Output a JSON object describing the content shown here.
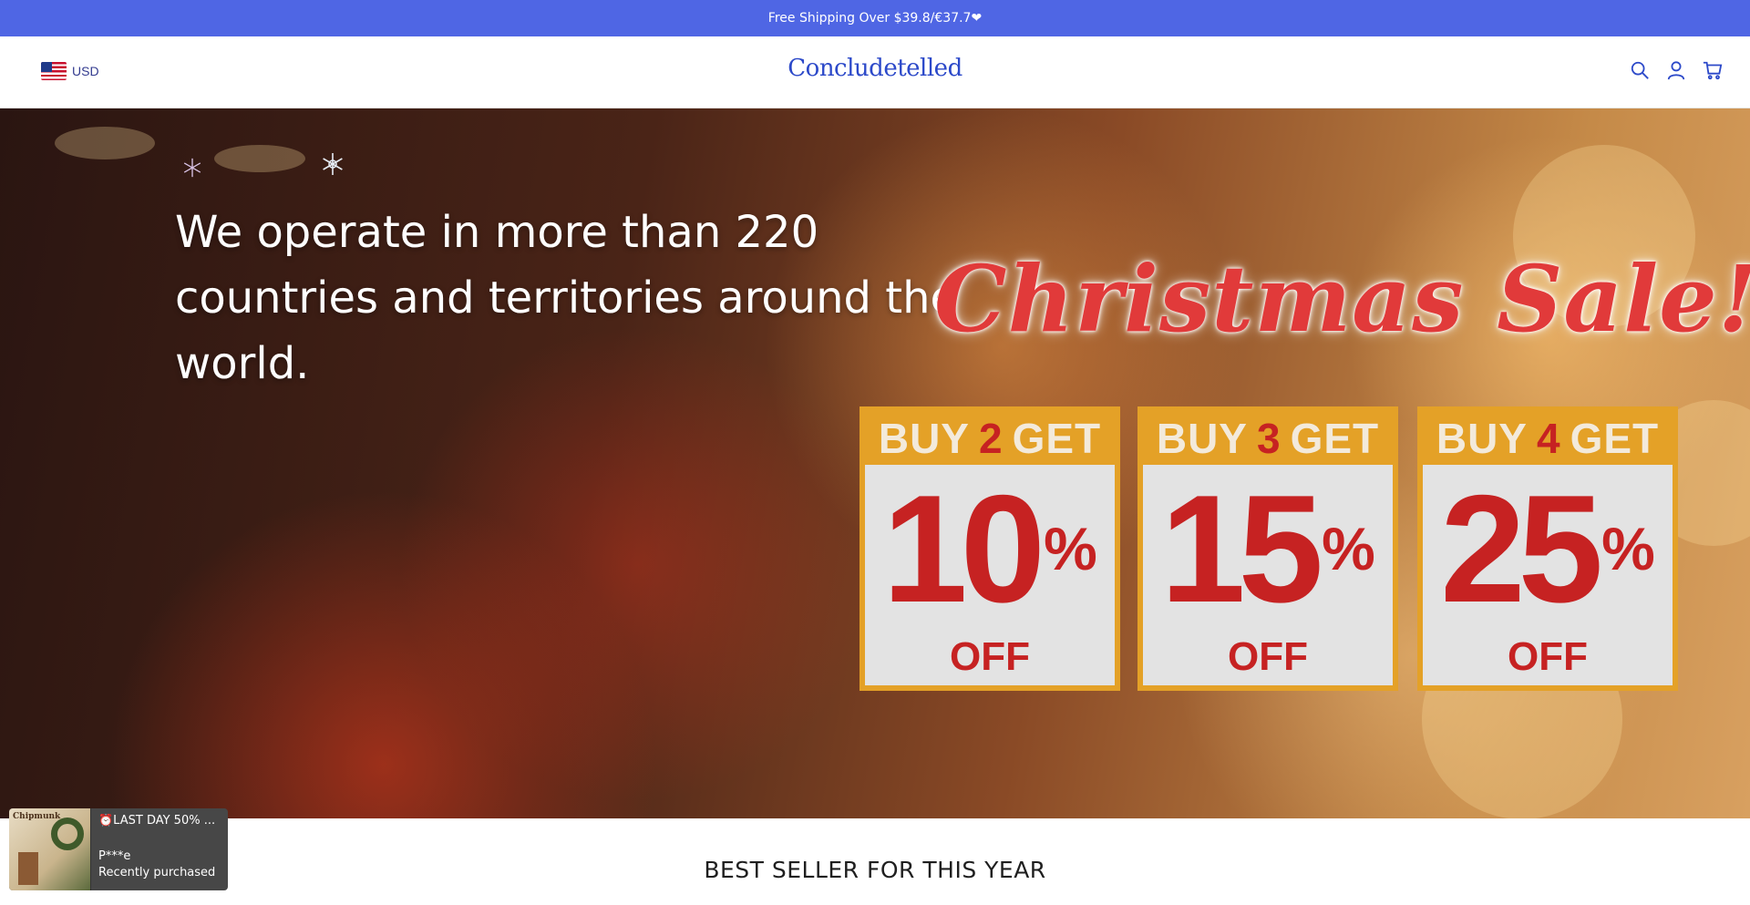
{
  "announcement": {
    "text": "Free Shipping Over $39.8/€37.7❤"
  },
  "header": {
    "currency": "USD",
    "logo": "Concludetelled",
    "icons": [
      "search-icon",
      "account-icon",
      "cart-icon"
    ]
  },
  "hero": {
    "headline": "We operate in more than 220 countries and territories around the world.",
    "sale_title": "Christmas Sale!",
    "offers": [
      {
        "buy_label": "BUY",
        "quantity": "2",
        "get_label": "GET",
        "percent": "10",
        "percent_sign": "%",
        "off_label": "OFF"
      },
      {
        "buy_label": "BUY",
        "quantity": "3",
        "get_label": "GET",
        "percent": "15",
        "percent_sign": "%",
        "off_label": "OFF"
      },
      {
        "buy_label": "BUY",
        "quantity": "4",
        "get_label": "GET",
        "percent": "25",
        "percent_sign": "%",
        "off_label": "OFF"
      }
    ]
  },
  "section": {
    "title": "BEST SELLER FOR THIS YEAR"
  },
  "purchase_popup": {
    "product": "⏰LAST DAY 50% ...",
    "buyer": "P***e",
    "status": "Recently purchased",
    "thumb_text": "Chipmunk"
  },
  "colors": {
    "announcement_bar": "#4f66e4",
    "logo": "#2c49c9",
    "offer_frame": "#e4a127",
    "offer_red": "#c62222"
  }
}
